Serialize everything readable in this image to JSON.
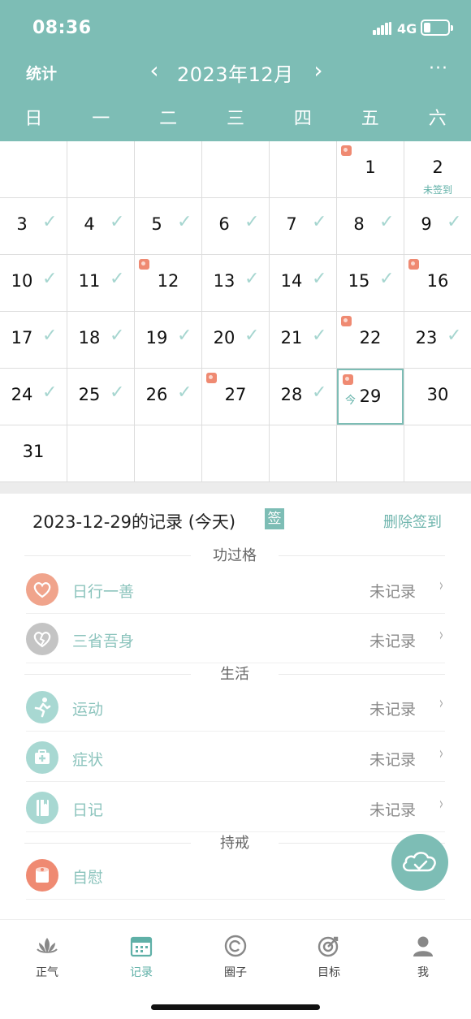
{
  "status_bar": {
    "time": "08:36",
    "network": "4G",
    "battery_level": 0.3
  },
  "header": {
    "stats_label": "统计",
    "prev_icon": "chevron-left-icon",
    "month_title": "2023年12月",
    "next_icon": "chevron-right-icon",
    "more_label": "···",
    "weekdays": [
      "日",
      "一",
      "二",
      "三",
      "四",
      "五",
      "六"
    ]
  },
  "calendar": {
    "weeks": [
      [
        {
          "day": ""
        },
        {
          "day": ""
        },
        {
          "day": ""
        },
        {
          "day": ""
        },
        {
          "day": ""
        },
        {
          "day": "1",
          "roll": true
        },
        {
          "day": "2",
          "note": "未签到"
        }
      ],
      [
        {
          "day": "3",
          "checked": true
        },
        {
          "day": "4",
          "checked": true
        },
        {
          "day": "5",
          "checked": true
        },
        {
          "day": "6",
          "checked": true
        },
        {
          "day": "7",
          "checked": true
        },
        {
          "day": "8",
          "checked": true
        },
        {
          "day": "9",
          "checked": true
        }
      ],
      [
        {
          "day": "10",
          "checked": true
        },
        {
          "day": "11",
          "checked": true
        },
        {
          "day": "12",
          "roll": true
        },
        {
          "day": "13",
          "checked": true
        },
        {
          "day": "14",
          "checked": true
        },
        {
          "day": "15",
          "checked": true
        },
        {
          "day": "16",
          "roll": true
        }
      ],
      [
        {
          "day": "17",
          "checked": true
        },
        {
          "day": "18",
          "checked": true
        },
        {
          "day": "19",
          "checked": true
        },
        {
          "day": "20",
          "checked": true
        },
        {
          "day": "21",
          "checked": true
        },
        {
          "day": "22",
          "roll": true
        },
        {
          "day": "23",
          "checked": true
        }
      ],
      [
        {
          "day": "24",
          "checked": true
        },
        {
          "day": "25",
          "checked": true
        },
        {
          "day": "26",
          "checked": true
        },
        {
          "day": "27",
          "roll": true
        },
        {
          "day": "28",
          "checked": true
        },
        {
          "day": "29",
          "roll": true,
          "today": true,
          "today_mark": "今"
        },
        {
          "day": "30"
        }
      ],
      [
        {
          "day": "31"
        },
        {
          "day": ""
        },
        {
          "day": ""
        },
        {
          "day": ""
        },
        {
          "day": ""
        },
        {
          "day": ""
        },
        {
          "day": ""
        }
      ]
    ]
  },
  "record": {
    "title": "2023-12-29的记录 (今天)",
    "sign_badge": "签",
    "delete_label": "删除签到"
  },
  "sections": [
    {
      "label": "功过格",
      "items": [
        {
          "label": "日行一善",
          "status": "未记录",
          "icon": "heart-icon",
          "color": "#f0a48c"
        },
        {
          "label": "三省吾身",
          "status": "未记录",
          "icon": "broken-heart-icon",
          "color": "#c4c4c4"
        }
      ]
    },
    {
      "label": "生活",
      "items": [
        {
          "label": "运动",
          "status": "未记录",
          "icon": "running-person-icon",
          "color": "#a8d8d2"
        },
        {
          "label": "症状",
          "status": "未记录",
          "icon": "medical-kit-icon",
          "color": "#a8d8d2"
        },
        {
          "label": "日记",
          "status": "未记录",
          "icon": "notebook-icon",
          "color": "#a8d8d2"
        }
      ]
    },
    {
      "label": "持戒",
      "items": [
        {
          "label": "自慰",
          "icon": "tissue-roll-icon",
          "color": "#ef8a72"
        }
      ]
    }
  ],
  "fab": {
    "icon": "cloud-sync-icon"
  },
  "tabbar": [
    {
      "label": "正气",
      "icon": "lotus-icon"
    },
    {
      "label": "记录",
      "icon": "calendar-icon",
      "active": true
    },
    {
      "label": "圈子",
      "icon": "circle-icon"
    },
    {
      "label": "目标",
      "icon": "target-icon"
    },
    {
      "label": "我",
      "icon": "user-icon"
    }
  ],
  "colors": {
    "accent": "#7dbdb5",
    "check": "#a6d6d0",
    "roll": "#ef8a72"
  }
}
